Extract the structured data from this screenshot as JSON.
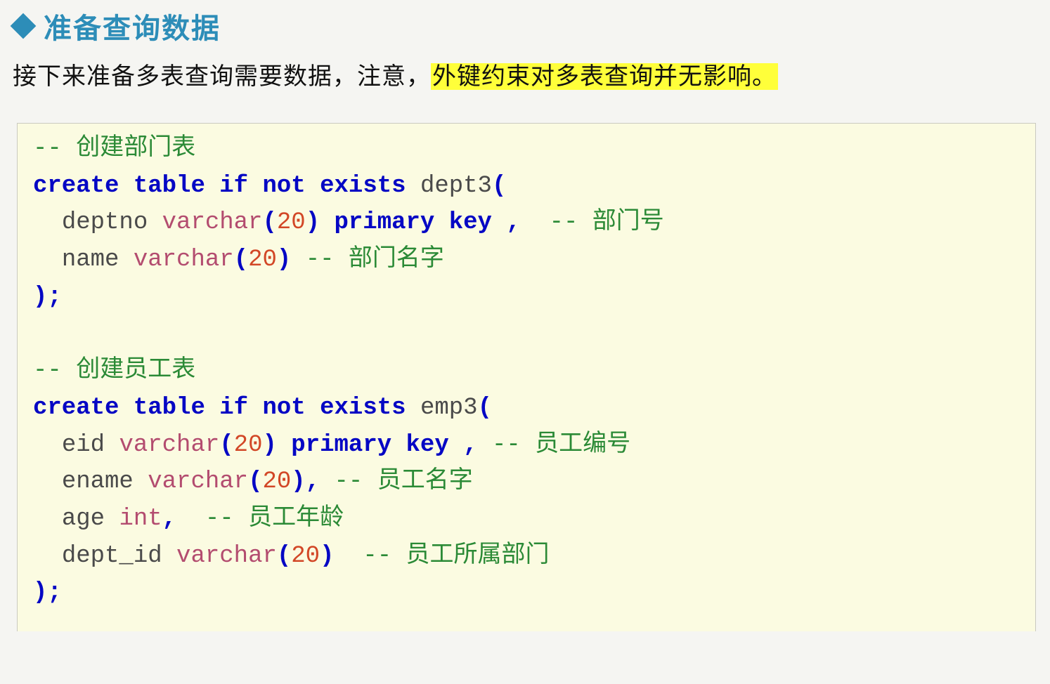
{
  "heading": "准备查询数据",
  "intro": {
    "prefix": "接下来准备多表查询需要数据，注意，",
    "highlight": "外键约束对多表查询并无影响。"
  },
  "code": {
    "c1": "-- 创建部门表",
    "kw_create": "create",
    "kw_table": "table",
    "kw_if": "if",
    "kw_not": "not",
    "kw_exists": "exists",
    "kw_primary": "primary",
    "kw_key": "key",
    "dept_table": "dept3",
    "deptno": "deptno",
    "varchar": "varchar",
    "n20": "20",
    "c_deptno": "-- 部门号",
    "name": "name",
    "c_name": "-- 部门名字",
    "c2": "-- 创建员工表",
    "emp_table": "emp3",
    "eid": "eid",
    "c_eid": "-- 员工编号",
    "ename": "ename",
    "c_ename": "-- 员工名字",
    "age": "age",
    "int": "int",
    "c_age": "-- 员工年龄",
    "dept_id": "dept_id",
    "c_dept_id": "-- 员工所属部门",
    "lparen": "(",
    "rparen": ")",
    "semi": ";",
    "comma": ",",
    "rparen_semi": ");"
  }
}
